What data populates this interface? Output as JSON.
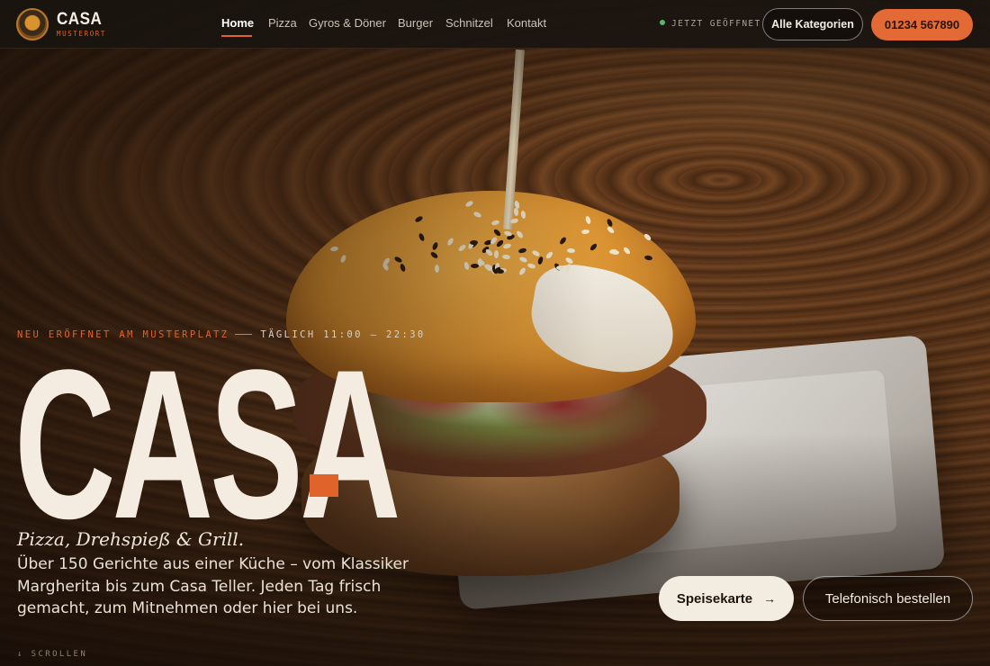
{
  "brand": {
    "name": "CASA",
    "subtitle": "MUSTERORT"
  },
  "nav": {
    "items": [
      {
        "label": "Home",
        "active": true
      },
      {
        "label": "Pizza",
        "active": false
      },
      {
        "label": "Gyros & Döner",
        "active": false
      },
      {
        "label": "Burger",
        "active": false
      },
      {
        "label": "Schnitzel",
        "active": false
      },
      {
        "label": "Kontakt",
        "active": false
      }
    ]
  },
  "header": {
    "status_text": "JETZT GEÖFFNET",
    "categories_button": "Alle Kategorien",
    "phone_button": "01234 567890"
  },
  "hero": {
    "eyebrow_left": "NEU ERÖFFNET AM MUSTERPLATZ",
    "eyebrow_right": "TÄGLICH 11:00 – 22:30",
    "title": "CASA",
    "tagline": "Pizza, Drehspieß & Grill.",
    "description": "Über 150 Gerichte aus einer Küche – vom Klassiker Margherita bis zum Casa Teller. Jeden Tag frisch gemacht, zum Mitnehmen oder hier bei uns.",
    "menu_button": "Speisekarte",
    "menu_button_icon": "→",
    "call_button": "Telefonisch bestellen",
    "scroll_hint": "↓ SCROLLEN"
  },
  "colors": {
    "accent": "#e0632b",
    "cream": "#f3ece0",
    "header_bg": "#1a1410",
    "open_dot": "#59b86a"
  },
  "icons": {
    "logo": "restaurant-logo-icon",
    "status": "status-dot-icon",
    "arrow": "arrow-right-icon"
  }
}
